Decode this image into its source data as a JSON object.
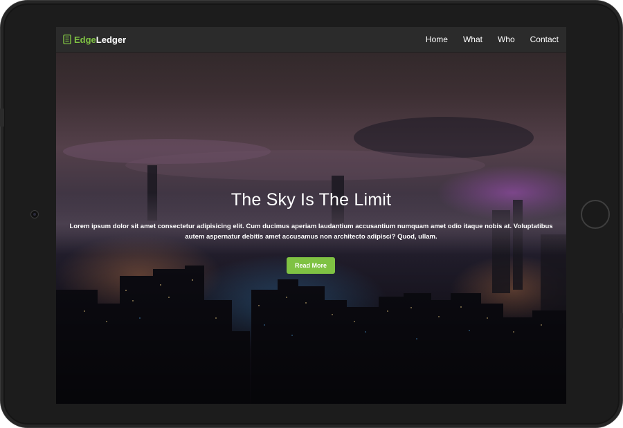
{
  "brand": {
    "prefix": "Edge",
    "suffix": "Ledger",
    "accent_color": "#7fc243",
    "icon": "ledger-book-icon"
  },
  "nav": {
    "items": [
      "Home",
      "What",
      "Who",
      "Contact"
    ]
  },
  "hero": {
    "title": "The Sky Is The Limit",
    "text": "Lorem ipsum dolor sit amet consectetur adipisicing elit. Cum ducimus aperiam laudantium accusantium numquam amet odio itaque nobis at. Voluptatibus autem aspernatur debitis amet accusamus non architecto adipisci? Quod, ullam.",
    "button_label": "Read More",
    "button_color": "#7fc243"
  }
}
